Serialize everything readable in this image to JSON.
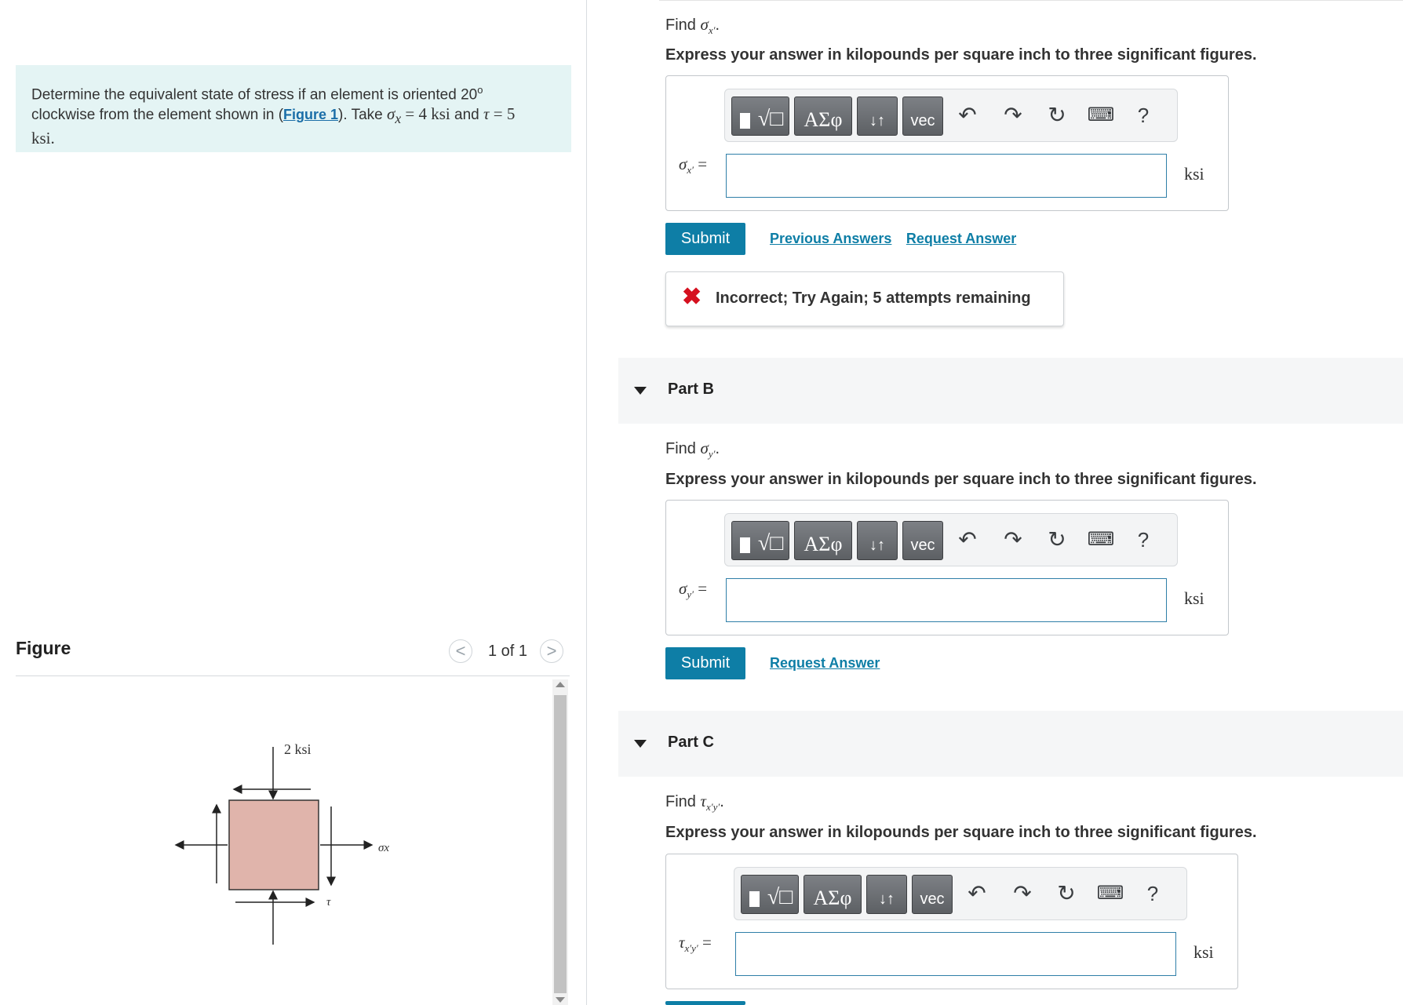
{
  "problem": {
    "text_1": "Determine the equivalent state of stress if an element is oriented 20",
    "degree": "o",
    "text_2": "clockwise from the element shown in (",
    "figure_link": "Figure 1",
    "text_3": "). Take ",
    "sigma_sym": "σ",
    "sigma_sub": "x",
    "sigma_val": " = 4 ksi",
    "and": " and ",
    "tau_sym": "τ",
    "tau_val": " = 5",
    "unit_line": "ksi."
  },
  "figure": {
    "title": "Figure",
    "counter": "1 of 1",
    "prev": "<",
    "next": ">",
    "label_2ksi": "2 ksi",
    "label_sigma": "σx",
    "label_tau": "τ",
    "element_color": "#e0b4ab"
  },
  "toolbar": {
    "sqrt_label": "√□",
    "greek_label": "ΑΣφ",
    "arrows_label": "↓↑",
    "vec_label": "vec",
    "undo": "↶",
    "redo": "↷",
    "reset": "↻",
    "keyboard": "⌨",
    "help": "?"
  },
  "partA": {
    "find_text": "Find ",
    "find_sym": "σ",
    "find_sub": "x′",
    "find_end": ".",
    "express": "Express your answer in kilopounds per square inch to three significant figures.",
    "var_sym": "σ",
    "var_sub": "x′",
    "equals": " =",
    "input_value": "",
    "unit": "ksi",
    "submit": "Submit",
    "previous_answers": "Previous Answers",
    "request_answer": "Request Answer",
    "feedback_icon": "✖",
    "feedback": "Incorrect; Try Again; 5 attempts remaining"
  },
  "partB": {
    "title": "Part B",
    "find_text": "Find ",
    "find_sym": "σ",
    "find_sub": "y′",
    "find_end": ".",
    "express": "Express your answer in kilopounds per square inch to three significant figures.",
    "var_sym": "σ",
    "var_sub": "y′",
    "equals": " =",
    "input_value": "",
    "unit": "ksi",
    "submit": "Submit",
    "request_answer": "Request Answer"
  },
  "partC": {
    "title": "Part C",
    "find_text": "Find ",
    "find_sym": "τ",
    "find_sub": "x′y′",
    "find_end": ".",
    "express": "Express your answer in kilopounds per square inch to three significant figures.",
    "var_sym": "τ",
    "var_sub": "x′y′",
    "equals": " =",
    "input_value": "",
    "unit": "ksi"
  },
  "colors": {
    "accent": "#0e7ea6",
    "problem_bg": "#e4f4f4",
    "error": "#d5101f"
  }
}
